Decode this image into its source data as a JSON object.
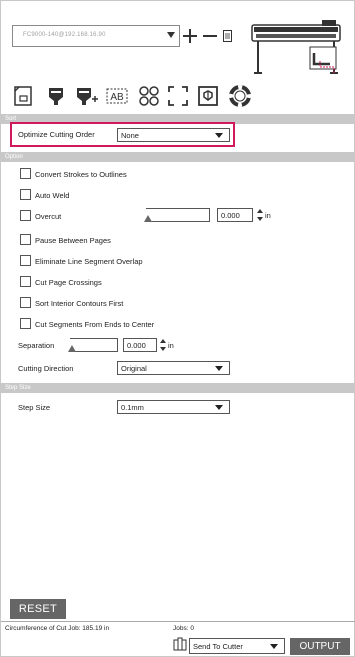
{
  "device": {
    "selector_value": "FC9000-140@192.168.16.90"
  },
  "toolbar": {
    "icons": [
      "page-setup-icon",
      "cut-settings-icon",
      "advanced-cut-settings-icon",
      "ab-text-icon",
      "registration-marks-icon",
      "crop-marks-icon",
      "design-settings-icon",
      "lifebuoy-icon"
    ]
  },
  "sort": {
    "section_label": "Sort",
    "optimize_label": "Optimize Cutting Order",
    "optimize_value": "None"
  },
  "option": {
    "section_label": "Option",
    "convert_strokes": "Convert Strokes to Outlines",
    "auto_weld": "Auto Weld",
    "overcut": "Overcut",
    "overcut_value": "0.000",
    "overcut_unit": "in",
    "pause_between_pages": "Pause Between Pages",
    "eliminate_overlap": "Eliminate Line Segment Overlap",
    "cut_page_crossings": "Cut Page Crossings",
    "sort_interior": "Sort Interior Contours First",
    "cut_segments": "Cut Segments From Ends to Center",
    "separation_label": "Separation",
    "separation_value": "0.000",
    "separation_unit": "in",
    "cutting_direction_label": "Cutting Direction",
    "cutting_direction_value": "Original"
  },
  "step_size": {
    "section_label": "Step Size",
    "label": "Step Size",
    "value": "0.1mm"
  },
  "footer": {
    "reset_label": "RESET",
    "circumference_text": "Circumference of Cut Job: 185.19 in",
    "jobs_text": "Jobs: 0",
    "send_to_value": "Send To Cutter",
    "output_label": "OUTPUT"
  },
  "colors": {
    "highlight": "#d0195c",
    "section_bar": "#c8c8c8",
    "button": "#666666"
  }
}
